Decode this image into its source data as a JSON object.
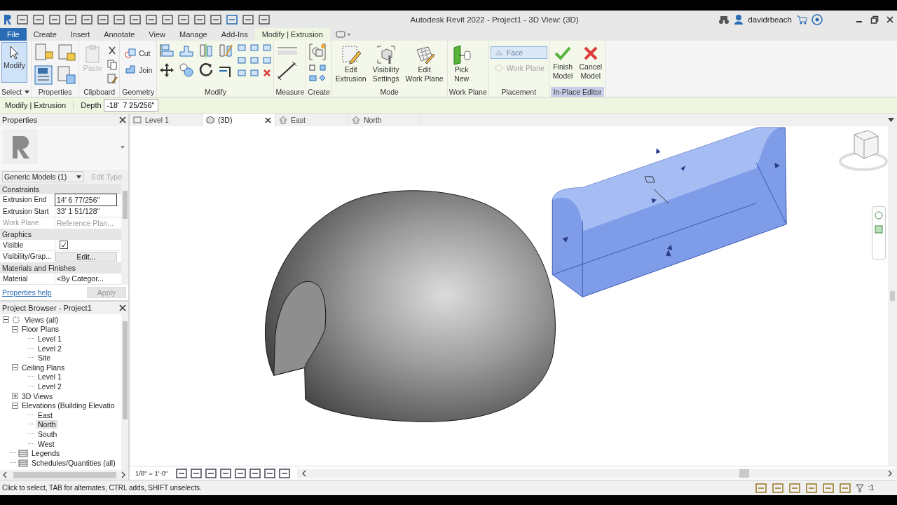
{
  "window": {
    "title": "Autodesk Revit 2022 - Project1 - 3D View: (3D)",
    "user": "davidrbeach"
  },
  "ribbon": {
    "tabs": [
      {
        "label": "File",
        "kind": "file",
        "selected": false
      },
      {
        "label": "Create",
        "kind": "tab",
        "selected": false
      },
      {
        "label": "Insert",
        "kind": "tab",
        "selected": false
      },
      {
        "label": "Annotate",
        "kind": "tab",
        "selected": false
      },
      {
        "label": "View",
        "kind": "tab",
        "selected": false
      },
      {
        "label": "Manage",
        "kind": "tab",
        "selected": false
      },
      {
        "label": "Add-Ins",
        "kind": "tab",
        "selected": false
      },
      {
        "label": "Modify | Extrusion",
        "kind": "tab",
        "selected": true
      }
    ],
    "panels": [
      {
        "label": "Select",
        "menu": true,
        "highlight": false,
        "tools": [
          {
            "kind": "large",
            "lines": [
              "Modify"
            ],
            "selected": true,
            "disabled": false
          }
        ]
      },
      {
        "label": "Properties",
        "menu": false,
        "highlight": false
      },
      {
        "label": "Clipboard",
        "menu": false,
        "highlight": false,
        "tools": [
          {
            "kind": "large",
            "lines": [
              "Paste"
            ],
            "selected": false,
            "disabled": true
          }
        ]
      },
      {
        "label": "Geometry",
        "menu": false,
        "highlight": false,
        "tools": [
          {
            "kind": "small",
            "lines": [
              "Cut"
            ],
            "selected": false,
            "disabled": false
          },
          {
            "kind": "small",
            "lines": [
              "Join"
            ],
            "selected": false,
            "disabled": false
          }
        ]
      },
      {
        "label": "Modify",
        "menu": false,
        "highlight": false
      },
      {
        "label": "Measure",
        "menu": false,
        "highlight": false
      },
      {
        "label": "Create",
        "menu": false,
        "highlight": false
      },
      {
        "label": "Mode",
        "menu": false,
        "highlight": false,
        "tools": [
          {
            "kind": "large",
            "lines": [
              "Edit",
              "Extrusion"
            ],
            "selected": false,
            "disabled": false
          },
          {
            "kind": "large",
            "lines": [
              "Visibility",
              "Settings"
            ],
            "selected": false,
            "disabled": false
          },
          {
            "kind": "large",
            "lines": [
              "Edit",
              "Work Plane"
            ],
            "selected": false,
            "disabled": false
          }
        ]
      },
      {
        "label": "Work Plane",
        "menu": false,
        "highlight": false,
        "tools": [
          {
            "kind": "large",
            "lines": [
              "Pick",
              "New"
            ],
            "selected": false,
            "disabled": false
          }
        ]
      },
      {
        "label": "Placement",
        "menu": false,
        "highlight": false,
        "tools": [
          {
            "kind": "small",
            "lines": [
              "Face"
            ],
            "selected": true,
            "disabled": true
          },
          {
            "kind": "small",
            "lines": [
              "Work Plane"
            ],
            "selected": false,
            "disabled": true
          }
        ]
      },
      {
        "label": "In-Place Editor",
        "menu": false,
        "highlight": true,
        "tools": [
          {
            "kind": "large",
            "lines": [
              "Finish",
              "Model"
            ],
            "selected": false,
            "disabled": false
          },
          {
            "kind": "large",
            "lines": [
              "Cancel",
              "Model"
            ],
            "selected": false,
            "disabled": false
          }
        ]
      }
    ]
  },
  "options_bar": {
    "context": "Modify | Extrusion",
    "depth_label": "Depth",
    "depth_value": "-18'  7 25/256\""
  },
  "properties": {
    "title": "Properties",
    "type_selector": "Generic Models (1)",
    "edit_type": {
      "label": "Edit Type",
      "disabled": true
    },
    "groups": [
      {
        "label": "Constraints",
        "rows": [
          {
            "kind": "text",
            "name": "Extrusion End",
            "value": "14'  6 77/256\"",
            "focused": true,
            "disabled": false
          },
          {
            "kind": "text",
            "name": "Extrusion Start",
            "value": "33'  1 51/128\"",
            "focused": false,
            "disabled": false
          },
          {
            "kind": "text",
            "name": "Work Plane",
            "value": "Reference Plan...",
            "focused": false,
            "disabled": true
          }
        ]
      },
      {
        "label": "Graphics",
        "rows": [
          {
            "kind": "checkbox",
            "name": "Visible",
            "checked": true,
            "focused": false,
            "disabled": false
          },
          {
            "kind": "button",
            "name": "Visibility/Grap...",
            "value": "Edit...",
            "focused": false,
            "disabled": false
          }
        ]
      },
      {
        "label": "Materials and Finishes",
        "rows": [
          {
            "kind": "text",
            "name": "Material",
            "value": "<By Categor...",
            "focused": false,
            "disabled": false
          }
        ]
      }
    ],
    "help_link": "Properties help",
    "apply": {
      "label": "Apply",
      "disabled": true
    }
  },
  "project_browser": {
    "title": "Project Browser - Project1",
    "tree": [
      {
        "label": "Views (all)",
        "kind": "views",
        "expanded": true,
        "selected": false,
        "children": [
          {
            "label": "Floor Plans",
            "kind": "folder",
            "expanded": true,
            "selected": false,
            "children": [
              {
                "label": "Level 1",
                "kind": "leaf",
                "selected": false
              },
              {
                "label": "Level 2",
                "kind": "leaf",
                "selected": false
              },
              {
                "label": "Site",
                "kind": "leaf",
                "selected": false
              }
            ]
          },
          {
            "label": "Ceiling Plans",
            "kind": "folder",
            "expanded": true,
            "selected": false,
            "children": [
              {
                "label": "Level 1",
                "kind": "leaf",
                "selected": false
              },
              {
                "label": "Level 2",
                "kind": "leaf",
                "selected": false
              }
            ]
          },
          {
            "label": "3D Views",
            "kind": "folder",
            "expanded": false,
            "selected": false
          },
          {
            "label": "Elevations (Building Elevatio",
            "kind": "folder",
            "expanded": true,
            "selected": false,
            "children": [
              {
                "label": "East",
                "kind": "leaf",
                "selected": false
              },
              {
                "label": "North",
                "kind": "leaf",
                "selected": true
              },
              {
                "label": "South",
                "kind": "leaf",
                "selected": false
              },
              {
                "label": "West",
                "kind": "leaf",
                "selected": false
              }
            ]
          }
        ]
      },
      {
        "label": "Legends",
        "kind": "table",
        "selected": false
      },
      {
        "label": "Schedules/Quantities (all)",
        "kind": "table",
        "selected": false
      }
    ]
  },
  "view_tabs": [
    {
      "label": "Level 1",
      "kind": "plan",
      "selected": false
    },
    {
      "label": "(3D)",
      "kind": "model",
      "selected": true
    },
    {
      "label": "East",
      "kind": "elevation",
      "selected": false
    },
    {
      "label": "North",
      "kind": "elevation",
      "selected": false
    }
  ],
  "view_control": {
    "scale": "1/8\" = 1'-0\""
  },
  "status_bar": {
    "message": "Click to select, TAB for alternates, CTRL adds, SHIFT unselects.",
    "filter_count": ":1"
  }
}
